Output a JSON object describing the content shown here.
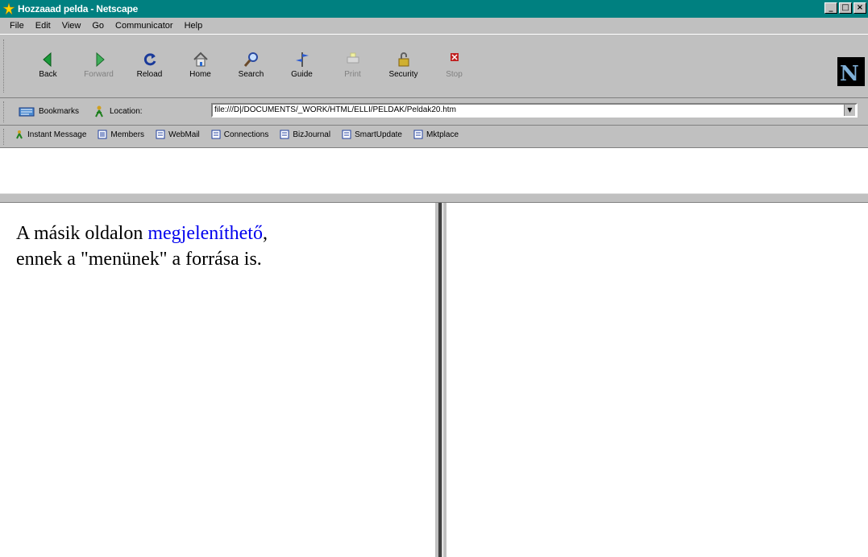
{
  "window": {
    "title": "Hozzaaad pelda - Netscape"
  },
  "window_controls": [
    "_",
    "□",
    "×"
  ],
  "menu": [
    "File",
    "Edit",
    "View",
    "Go",
    "Communicator",
    "Help"
  ],
  "nav_buttons": [
    {
      "label": "Back",
      "icon": "back-arrow-icon"
    },
    {
      "label": "Forward",
      "icon": "forward-arrow-icon"
    },
    {
      "label": "Reload",
      "icon": "reload-icon"
    },
    {
      "label": "Home",
      "icon": "home-icon"
    },
    {
      "label": "Search",
      "icon": "search-icon"
    },
    {
      "label": "Guide",
      "icon": "guide-icon"
    },
    {
      "label": "Print",
      "icon": "print-icon"
    },
    {
      "label": "Security",
      "icon": "security-icon"
    },
    {
      "label": "Stop",
      "icon": "stop-icon"
    }
  ],
  "location": {
    "bookmarks_label": "Bookmarks",
    "location_label": "Location:",
    "url": "file:///D|/DOCUMENTS/_WORK/HTML/ELLI/PELDAK/Peldak20.htm",
    "dropdown": "▼"
  },
  "personal_toolbar": [
    "Instant Message",
    "Members",
    "WebMail",
    "Connections",
    "BizJournal",
    "SmartUpdate",
    "Mktplace"
  ],
  "brand": {
    "logo_letter": "N"
  },
  "content": {
    "line1_prefix": "A másik oldalon ",
    "line1_link": "megjeleníthető",
    "line1_suffix": ",",
    "line2": "ennek a \"menünek\" a forrása is."
  }
}
